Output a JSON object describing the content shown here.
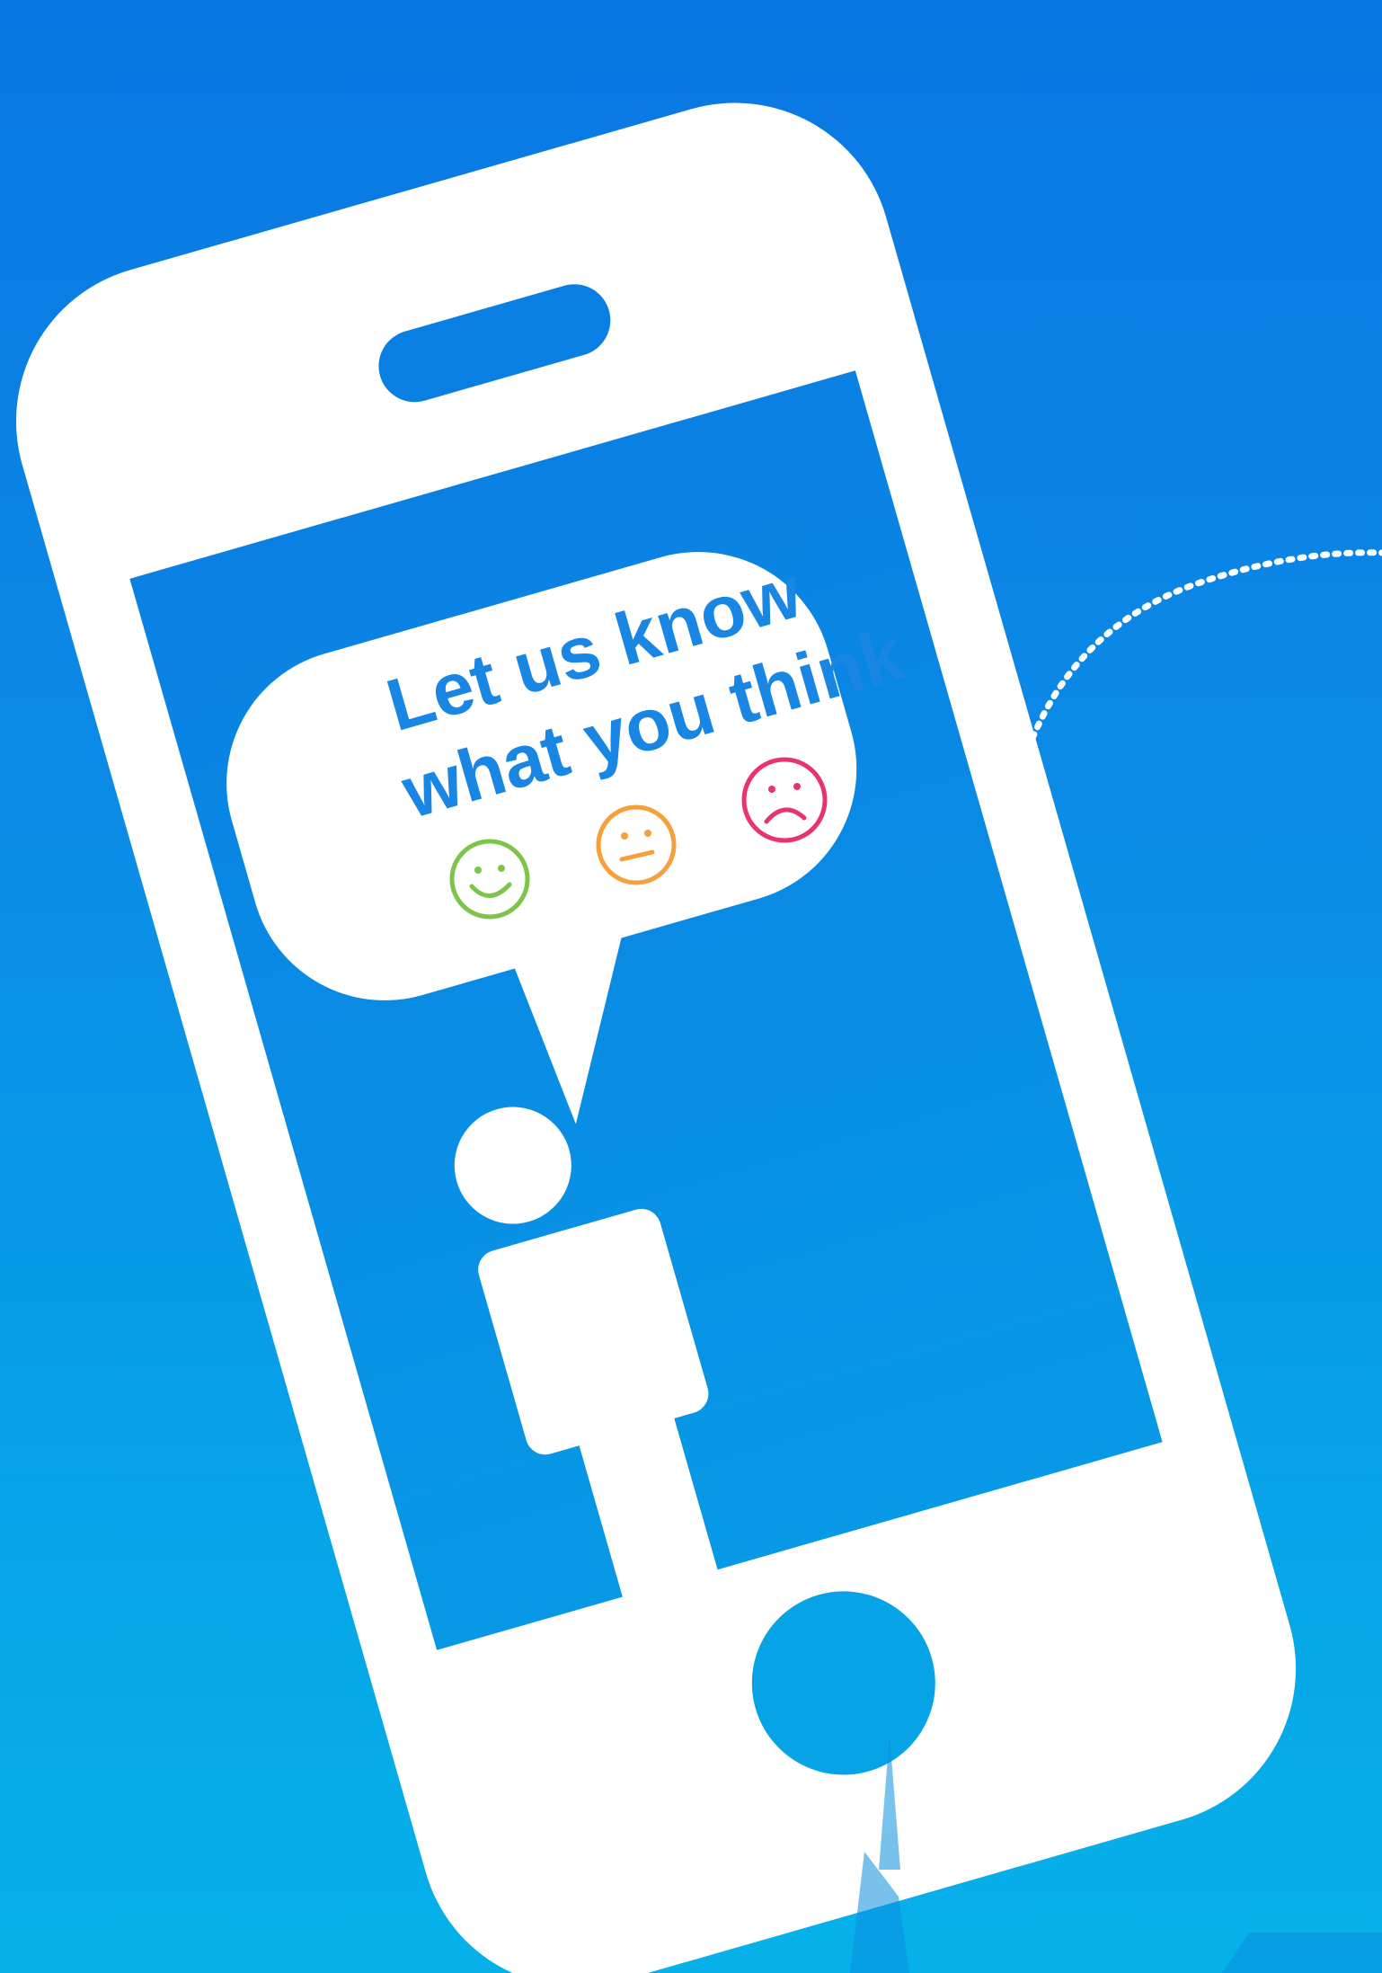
{
  "speech_bubble": {
    "line1": "Let us know",
    "line2": "what you think"
  },
  "faces": [
    {
      "mood": "happy",
      "icon": "happy-face-icon",
      "color": "#7dc54a"
    },
    {
      "mood": "neutral",
      "icon": "neutral-face-icon",
      "color": "#f5a03b"
    },
    {
      "mood": "sad",
      "icon": "sad-face-icon",
      "color": "#e8336e"
    }
  ],
  "colors": {
    "background_top": "#0a76e3",
    "background_bottom": "#06b1e9",
    "screen": "#0a8de6",
    "phone_body": "#ffffff",
    "text": "#1a86e4"
  }
}
